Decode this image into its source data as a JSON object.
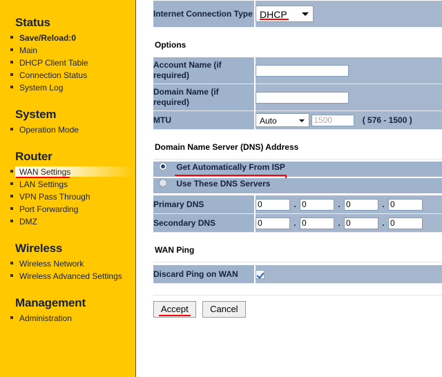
{
  "sidebar": {
    "groups": [
      {
        "title": "Status",
        "items": [
          {
            "label": "Save/Reload:0",
            "bold": true,
            "current": false
          },
          {
            "label": "Main",
            "bold": false,
            "current": false
          },
          {
            "label": "DHCP Client Table",
            "bold": false,
            "current": false
          },
          {
            "label": "Connection Status",
            "bold": false,
            "current": false
          },
          {
            "label": "System Log",
            "bold": false,
            "current": false
          }
        ]
      },
      {
        "title": "System",
        "items": [
          {
            "label": "Operation Mode",
            "bold": false,
            "current": false
          }
        ]
      },
      {
        "title": "Router",
        "items": [
          {
            "label": "WAN Settings",
            "bold": false,
            "current": true
          },
          {
            "label": "LAN Settings",
            "bold": false,
            "current": false
          },
          {
            "label": "VPN Pass Through",
            "bold": false,
            "current": false
          },
          {
            "label": "Port Forwarding",
            "bold": false,
            "current": false
          },
          {
            "label": "DMZ",
            "bold": false,
            "current": false
          }
        ]
      },
      {
        "title": "Wireless",
        "items": [
          {
            "label": "Wireless Network",
            "bold": false,
            "current": false
          },
          {
            "label": "Wireless Advanced Settings",
            "bold": false,
            "current": false
          }
        ]
      },
      {
        "title": "Management",
        "items": [
          {
            "label": "Administration",
            "bold": false,
            "current": false
          }
        ]
      }
    ]
  },
  "main": {
    "connection_type": {
      "label": "Internet Connection Type",
      "value": "DHCP"
    },
    "options": {
      "heading": "Options",
      "account_name": {
        "label": "Account Name (if required)",
        "value": ""
      },
      "domain_name": {
        "label": "Domain Name (if required)",
        "value": ""
      },
      "mtu": {
        "label": "MTU",
        "mode": "Auto",
        "value": "1500",
        "range_hint": "( 576 - 1500 )"
      }
    },
    "dns": {
      "heading": "Domain Name Server (DNS) Address",
      "option_auto": "Get Automatically From ISP",
      "option_manual": "Use These DNS Servers",
      "selected": "auto",
      "primary": {
        "label": "Primary DNS",
        "octets": [
          "0",
          "0",
          "0",
          "0"
        ]
      },
      "secondary": {
        "label": "Secondary DNS",
        "octets": [
          "0",
          "0",
          "0",
          "0"
        ]
      }
    },
    "wan_ping": {
      "heading": "WAN Ping",
      "discard": {
        "label": "Discard Ping on WAN",
        "checked": true
      }
    },
    "buttons": {
      "accept": "Accept",
      "cancel": "Cancel"
    }
  }
}
